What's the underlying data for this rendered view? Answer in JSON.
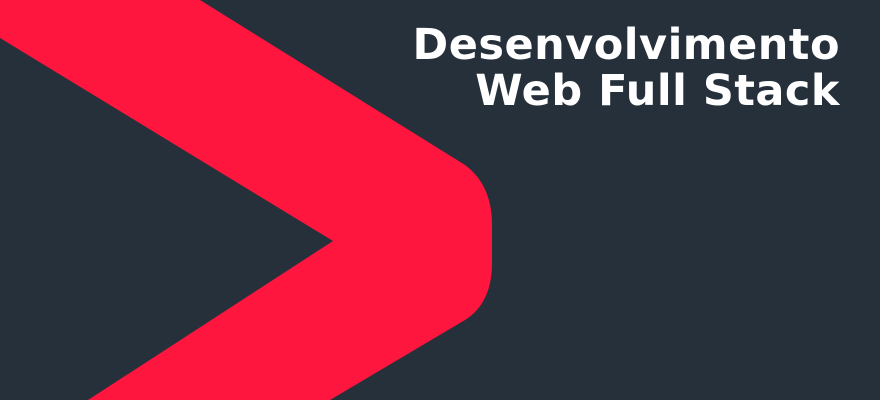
{
  "banner": {
    "title_line_1": "Desenvolvimento",
    "title_line_2": "Web Full Stack"
  },
  "colors": {
    "background": "#26303a",
    "accent": "#ff163e",
    "text": "#ffffff"
  },
  "icons": {
    "chevron": "chevron-right-icon"
  }
}
